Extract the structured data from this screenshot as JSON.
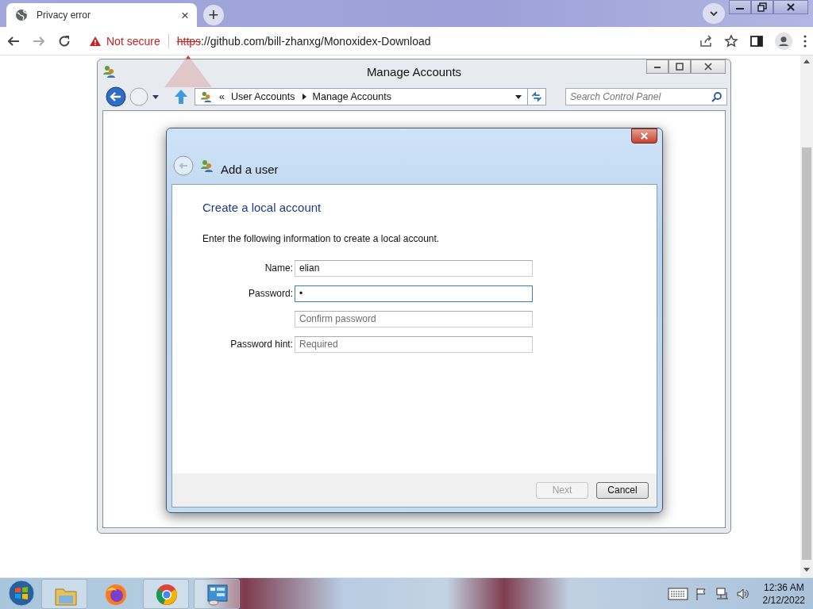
{
  "browser": {
    "tab": {
      "title": "Privacy error",
      "close": "×"
    },
    "new_tab": "+",
    "address": {
      "security": "Not secure",
      "scheme": "https",
      "url_rest": "://github.com/bill-zhanxg/Monoxidex-Download"
    }
  },
  "window": {
    "title": "Manage Accounts",
    "breadcrumb": {
      "prefix": "«",
      "items": [
        "User Accounts",
        "Manage Accounts"
      ]
    },
    "search": {
      "placeholder": "Search Control Panel"
    }
  },
  "dialog": {
    "title": "Add a user",
    "heading": "Create a local account",
    "instruction": "Enter the following information to create a local account.",
    "fields": [
      {
        "label": "Name:",
        "value": "elian",
        "focused": false
      },
      {
        "label": "Password:",
        "value": "•",
        "focused": true
      },
      {
        "placeholder": "Confirm password",
        "focused": false
      },
      {
        "label": "Password hint:",
        "placeholder": "Required",
        "focused": false
      }
    ],
    "buttons": [
      {
        "label": "Next",
        "disabled": true
      },
      {
        "label": "Cancel",
        "disabled": false
      }
    ]
  },
  "taskbar": {
    "apps": [
      {
        "kind": "explorer",
        "running": true
      },
      {
        "kind": "firefox",
        "running": false
      },
      {
        "kind": "chrome",
        "running": true
      },
      {
        "kind": "control-panel",
        "running": true
      }
    ],
    "clock": {
      "time": "12:36 AM",
      "date": "2/12/2022"
    }
  }
}
